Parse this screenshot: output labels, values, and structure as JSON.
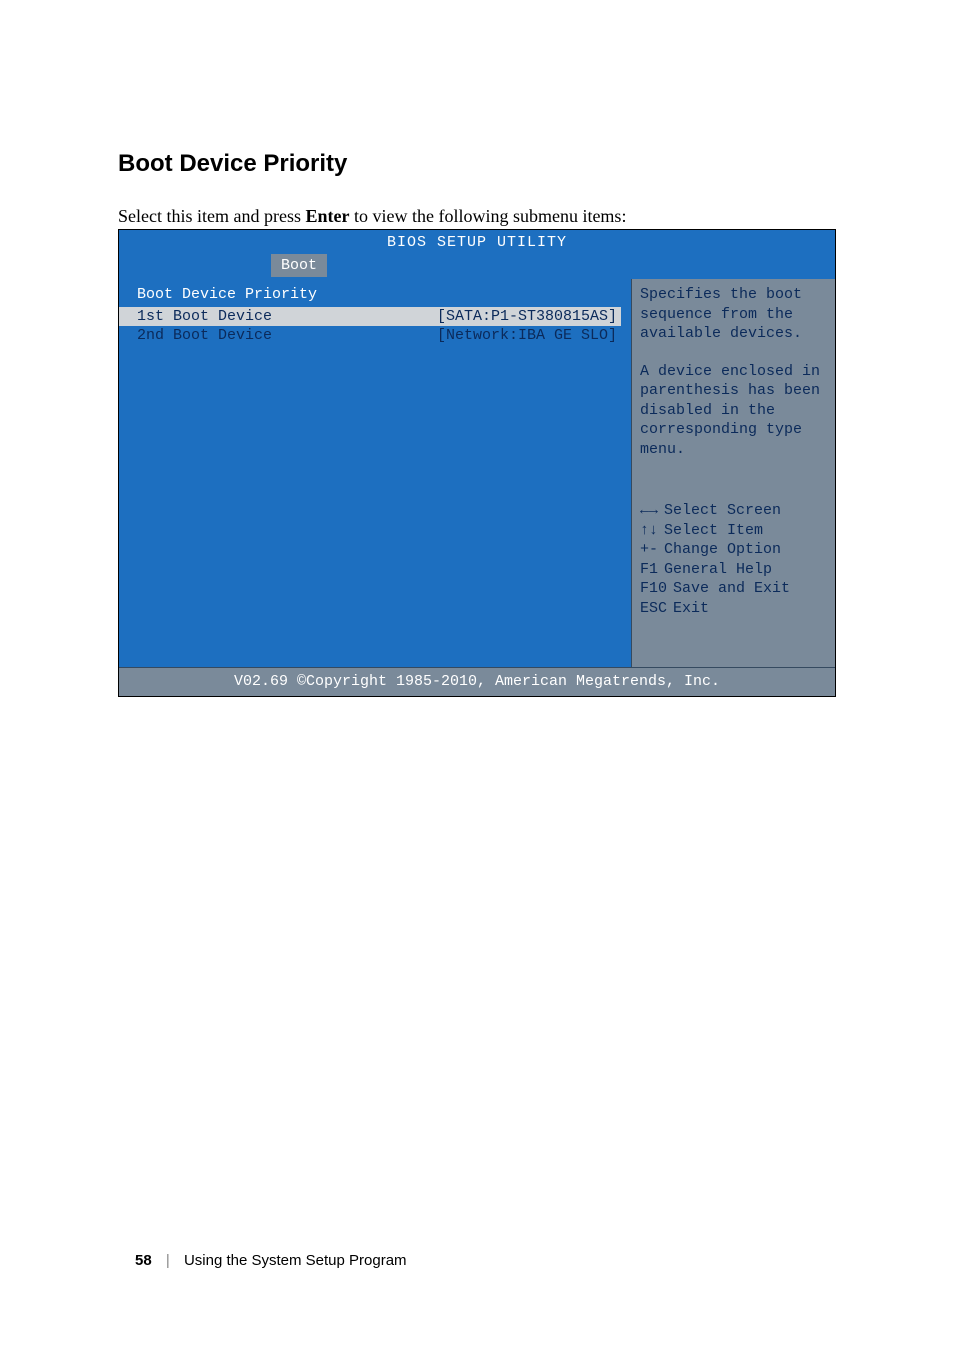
{
  "heading": "Boot Device Priority",
  "intro_pre": "Select this item and press ",
  "intro_bold": "Enter",
  "intro_post": " to view the following submenu items:",
  "bios": {
    "title": "BIOS SETUP UTILITY",
    "tab": "Boot",
    "left": {
      "section_title": "Boot Device Priority",
      "row1_label": "1st Boot Device",
      "row1_value": "[SATA:P1-ST380815AS]",
      "row2_label": "2nd Boot Device",
      "row2_value": "[Network:IBA GE SLO]"
    },
    "help": {
      "line1": "Specifies the boot",
      "line2": "sequence from the",
      "line3": "available devices.",
      "line4": "A device enclosed in",
      "line5": "parenthesis has been",
      "line6": "disabled in the",
      "line7": "corresponding type",
      "line8": "menu."
    },
    "nav": {
      "select_screen_arrows": "←→",
      "select_screen": "Select Screen",
      "select_item_arrows": "↑↓",
      "select_item": "Select Item",
      "change_option_key": "+-",
      "change_option": "Change Option",
      "general_help_key": "F1",
      "general_help": "General Help",
      "save_exit_key": "F10",
      "save_exit": "Save and Exit",
      "exit_key": "ESC",
      "exit": "Exit"
    },
    "footer": "V02.69 ©Copyright 1985-2010, American Megatrends, Inc."
  },
  "page": {
    "number": "58",
    "section": "Using the System Setup Program"
  }
}
